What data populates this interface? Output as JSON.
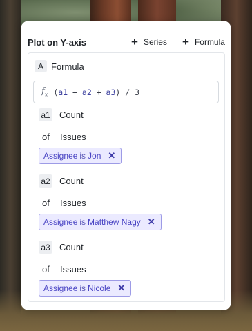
{
  "panel": {
    "title": "Plot on Y-axis",
    "add_series_label": "Series",
    "add_formula_label": "Formula",
    "plus_icon": "+"
  },
  "formula": {
    "letter": "A",
    "title": "Formula",
    "expression_parts": [
      "(",
      "a1",
      " + ",
      "a2",
      " + ",
      "a3",
      ") / 3"
    ]
  },
  "variables": [
    {
      "id": "a1",
      "aggregation": "Count",
      "of_label": "of",
      "entity": "Issues",
      "filter": {
        "field": "Assignee",
        "operator": "is",
        "value": "Jon"
      }
    },
    {
      "id": "a2",
      "aggregation": "Count",
      "of_label": "of",
      "entity": "Issues",
      "filter": {
        "field": "Assignee",
        "operator": "is",
        "value": "Matthew Nagy"
      }
    },
    {
      "id": "a3",
      "aggregation": "Count",
      "of_label": "of",
      "entity": "Issues",
      "filter": {
        "field": "Assignee",
        "operator": "is",
        "value": "Nicole"
      }
    }
  ],
  "colors": {
    "accent": "#4a45c4",
    "chip_bg": "#ebeaff",
    "chip_border": "#9d9be6"
  }
}
